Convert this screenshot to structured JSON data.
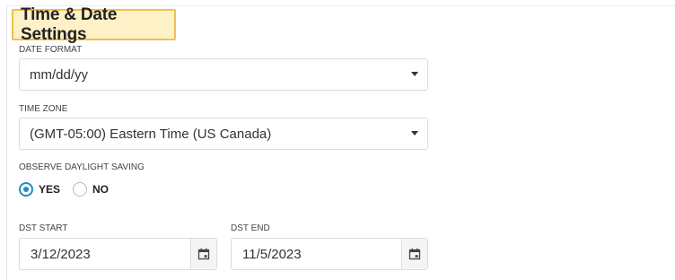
{
  "title": "Time & Date Settings",
  "date_format": {
    "label": "DATE FORMAT",
    "value": "mm/dd/yy"
  },
  "time_zone": {
    "label": "TIME ZONE",
    "value": "(GMT-05:00) Eastern Time (US Canada)"
  },
  "daylight_saving": {
    "label": "OBSERVE DAYLIGHT SAVING",
    "options": [
      {
        "label": "YES",
        "selected": true
      },
      {
        "label": "NO",
        "selected": false
      }
    ]
  },
  "dst_start": {
    "label": "DST START",
    "value": "3/12/2023"
  },
  "dst_end": {
    "label": "DST END",
    "value": "11/5/2023"
  },
  "colors": {
    "title_bg": "#fff1c7",
    "title_border": "#f0c04e",
    "radio_accent": "#1f8ec4"
  },
  "icons": {
    "select_caret": "chevron-down-icon",
    "calendar": "calendar-icon"
  }
}
